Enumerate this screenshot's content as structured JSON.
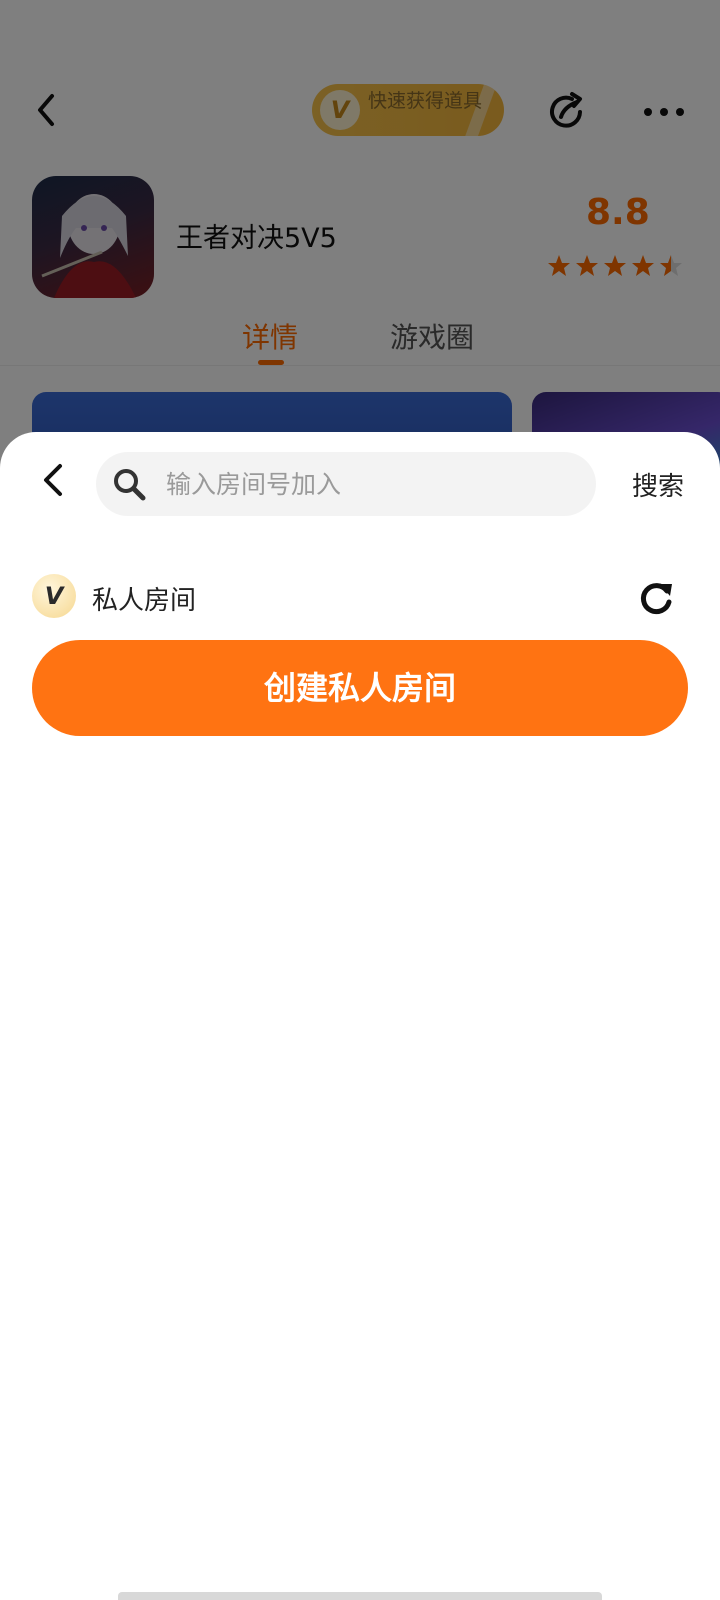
{
  "background": {
    "promo_text": "快速获得道具",
    "game_title": "王者对决5V5",
    "rating": "8.8",
    "rating_stars": 4.5,
    "tabs": [
      "详情",
      "游戏圈"
    ]
  },
  "sheet": {
    "search_placeholder": "输入房间号加入",
    "search_label": "搜索",
    "room_badge": "V",
    "room_title": "私人房间",
    "create_label": "创建私人房间"
  },
  "colors": {
    "accent": "#ff7312",
    "rating": "#ff6a00"
  },
  "icons": [
    "back-arrow-icon",
    "share-icon",
    "more-icon",
    "search-icon",
    "refresh-icon",
    "star-icon"
  ]
}
